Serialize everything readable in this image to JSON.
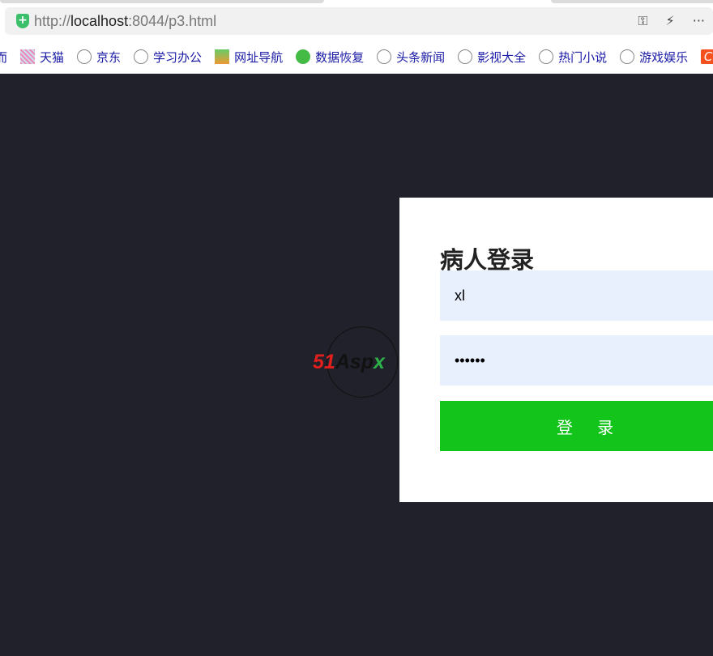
{
  "browser": {
    "url_prefix": "http://",
    "url_host": "localhost",
    "url_rest": ":8044/p3.html",
    "icons": [
      "key-icon",
      "bolt-icon",
      "more-icon"
    ],
    "bookmarks": [
      {
        "label": "天猫",
        "icon": "tmall"
      },
      {
        "label": "京东",
        "icon": "globe"
      },
      {
        "label": "学习办公",
        "icon": "globe"
      },
      {
        "label": "网址导航",
        "icon": "nav2345"
      },
      {
        "label": "数据恢复",
        "icon": "recovery"
      },
      {
        "label": "头条新闻",
        "icon": "globe"
      },
      {
        "label": "影视大全",
        "icon": "globe"
      },
      {
        "label": "热门小说",
        "icon": "globe"
      },
      {
        "label": "游戏娱乐",
        "icon": "globe"
      }
    ],
    "partial_left": "而",
    "partial_right": "C"
  },
  "login": {
    "title": "病人登录",
    "username": "xl",
    "password": "••••••",
    "submit": "登 录"
  },
  "watermark": {
    "text_red": "51",
    "text_dark": "Asp",
    "text_green": "x"
  },
  "colors": {
    "background": "#20212a",
    "button": "#13c41b",
    "field": "#e8f0fe"
  }
}
